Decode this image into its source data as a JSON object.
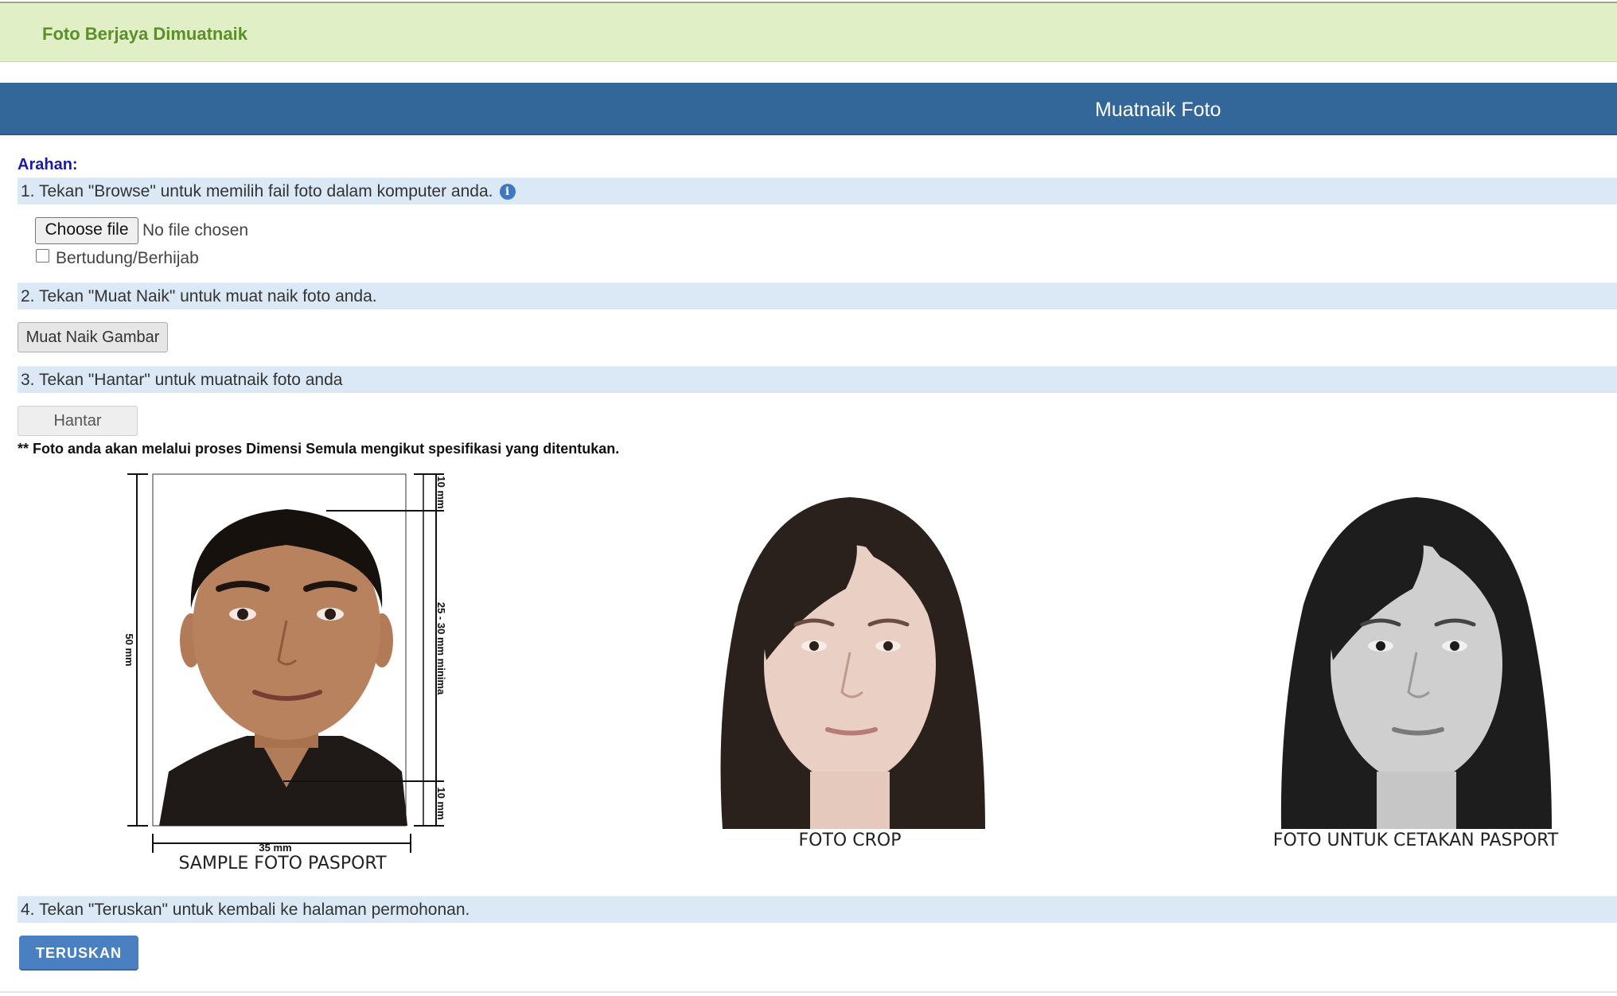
{
  "alert": {
    "message": "Foto Berjaya Dimuatnaik"
  },
  "panel": {
    "title": "Muatnaik Foto"
  },
  "instructions": {
    "heading": "Arahan:",
    "step1": "1. Tekan \"Browse\" untuk memilih fail foto dalam komputer anda.",
    "step2": "2. Tekan \"Muat Naik\" untuk muat naik foto anda.",
    "step3": "3. Tekan \"Hantar\" untuk muatnaik foto anda",
    "step4": "4. Tekan \"Teruskan\" untuk kembali ke halaman permohonan."
  },
  "file_input": {
    "button_label": "Choose file",
    "status": "No file chosen"
  },
  "hijab_checkbox": {
    "label": "Bertudung/Berhijab",
    "checked": false
  },
  "buttons": {
    "upload": "Muat Naik Gambar",
    "submit": "Hantar",
    "continue": "TERUSKAN"
  },
  "note": "** Foto anda akan melalui proses Dimensi Semula mengikut spesifikasi yang ditentukan.",
  "sample_photo": {
    "caption": "SAMPLE FOTO PASPORT",
    "dims": {
      "height": "50 mm",
      "width": "35 mm",
      "top_margin": "10 mm",
      "face": "25 - 30 mm minima",
      "bottom_margin": "10 mm"
    }
  },
  "crop_photo": {
    "caption": "FOTO CROP"
  },
  "print_photo": {
    "caption": "FOTO UNTUK CETAKAN PASPORT"
  },
  "colors": {
    "success_bg": "#e1efc7",
    "success_text": "#5a8f2a",
    "header_bg": "#336699",
    "step_bg": "#dbe8f5",
    "primary_button": "#4a7fc1"
  }
}
